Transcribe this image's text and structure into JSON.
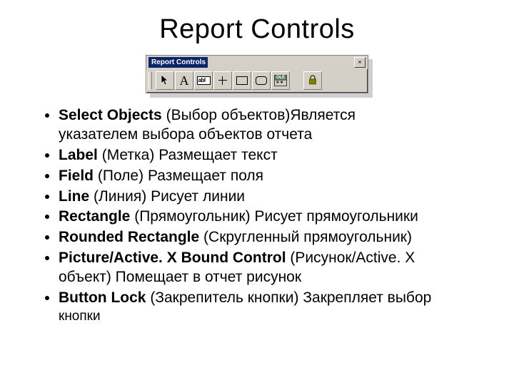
{
  "title": "Report Controls",
  "toolbar": {
    "title": "Report Controls",
    "buttons": {
      "select_objects": "Select Objects",
      "label": "Label",
      "field": "Field",
      "line": "Line",
      "rectangle": "Rectangle",
      "rounded_rectangle": "Rounded Rectangle",
      "picture_ole": "Picture/ActiveX Bound Control",
      "button_lock": "Button Lock"
    },
    "field_glyph": "abl",
    "label_glyph": "A",
    "ole_glyph": "OLE",
    "close_glyph": "×"
  },
  "items": [
    {
      "name": "Select Objects",
      "paren": "(Выбор объектов)",
      "desc_inline": "Является",
      "desc_cont": "указателем выбора объектов отчета"
    },
    {
      "name": "Label",
      "paren": "(Метка)",
      "desc_inline": "Размещает текст"
    },
    {
      "name": "Field",
      "paren": "(Поле)",
      "desc_inline": "Размещает поля"
    },
    {
      "name": "Line",
      "paren": "(Линия)",
      "desc_inline": "Рисует линии"
    },
    {
      "name": "Rectangle",
      "paren": "(Прямоугольник)",
      "desc_inline": "Рисует прямоугольники"
    },
    {
      "name": "Rounded Rectangle",
      "paren": "(Скругленный прямоугольник)",
      "desc_inline": ""
    },
    {
      "name": "Picture/Active. X Bound Control",
      "paren": "(Рисунок/Active. X",
      "desc_inline": "",
      "desc_cont": "объект) Помещает в отчет рисунок"
    },
    {
      "name": "Button Lock",
      "paren": "(Закрепитель кнопки)",
      "desc_inline": "Закрепляет выбор",
      "desc_cont_small": "кнопки"
    }
  ]
}
